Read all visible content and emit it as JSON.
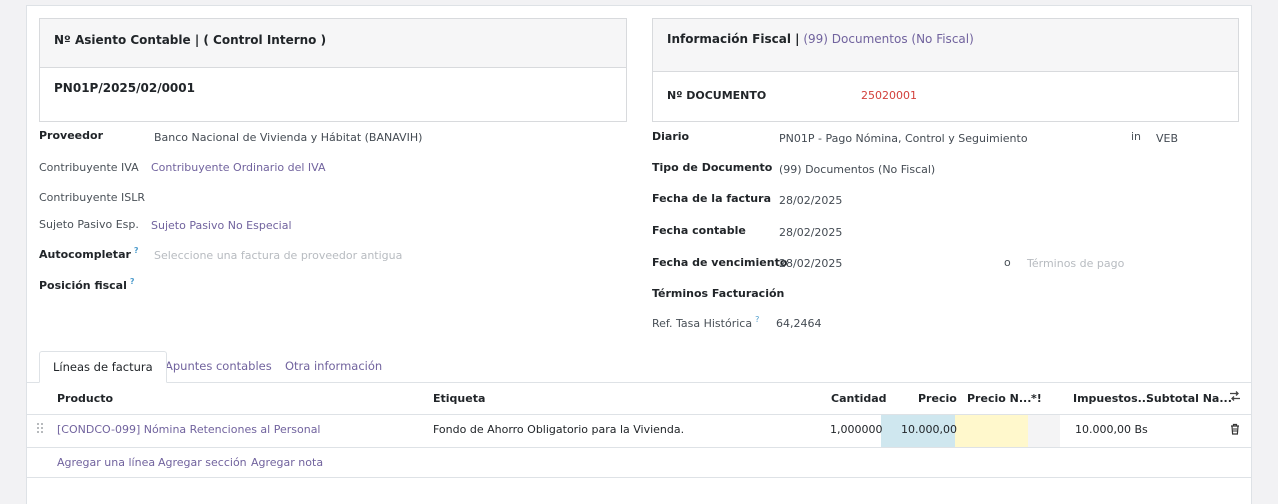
{
  "asiento": {
    "header": "Nº Asiento Contable | ( Control Interno )",
    "number": "PN01P/2025/02/0001"
  },
  "fiscal": {
    "header_label": "Información Fiscal |",
    "header_value": "(99) Documentos (No Fiscal)",
    "doc_label": "Nº DOCUMENTO",
    "doc_value": "25020001"
  },
  "left_fields": {
    "proveedor": {
      "label": "Proveedor",
      "value": "Banco Nacional de Vivienda y Hábitat (BANAVIH)"
    },
    "contribuyente_iva": {
      "label": "Contribuyente IVA",
      "value": "Contribuyente Ordinario del IVA"
    },
    "contribuyente_islr": {
      "label": "Contribuyente ISLR"
    },
    "sujeto_pasivo": {
      "label": "Sujeto Pasivo Esp.",
      "value": "Sujeto Pasivo No Especial"
    },
    "autocompletar": {
      "label": "Autocompletar",
      "help": "?",
      "placeholder": "Seleccione una factura de proveedor antigua"
    },
    "posicion_fiscal": {
      "label": "Posición fiscal",
      "help": "?"
    }
  },
  "right_fields": {
    "diario": {
      "label": "Diario",
      "value": "PN01P - Pago Nómina, Control y Seguimiento",
      "in_label": "in",
      "currency": "VEB"
    },
    "tipo_documento": {
      "label": "Tipo de Documento",
      "value": "(99) Documentos (No Fiscal)"
    },
    "fecha_factura": {
      "label": "Fecha de la factura",
      "value": "28/02/2025"
    },
    "fecha_contable": {
      "label": "Fecha contable",
      "value": "28/02/2025"
    },
    "fecha_vencimiento": {
      "label": "Fecha de vencimiento",
      "value": "28/02/2025",
      "or_label": "o",
      "terms_placeholder": "Términos de pago"
    },
    "terminos_facturacion": {
      "label": "Términos Facturación"
    },
    "ref_tasa": {
      "label": "Ref. Tasa Histórica",
      "help": "?",
      "value": "64,2464"
    }
  },
  "tabs": [
    {
      "label": "Líneas de factura",
      "active": true
    },
    {
      "label": "Apuntes contables",
      "active": false
    },
    {
      "label": "Otra información",
      "active": false
    }
  ],
  "table": {
    "columns": {
      "producto": "Producto",
      "etiqueta": "Etiqueta",
      "cantidad": "Cantidad",
      "precio": "Precio",
      "precio_neto": "Precio N...",
      "excl": "*!",
      "impuestos": "Impuestos...",
      "subtotal": "Subtotal Na..."
    },
    "rows": [
      {
        "producto": "[CONDCO-099] Nómina Retenciones al Personal",
        "etiqueta": "Fondo de Ahorro Obligatorio para la Vivienda.",
        "cantidad": "1,000000",
        "precio": "10.000,00",
        "precio_neto": "",
        "impuestos": "10.000,00 Bs",
        "subtotal": ""
      }
    ],
    "add_links": [
      "Agregar una línea",
      "Agregar sección",
      "Agregar nota"
    ]
  },
  "colors": {
    "accent": "#71639e",
    "price_cell": "#cfe7ef",
    "net_price_cell": "#fff8cc",
    "doc_number": "#d23f3a"
  }
}
